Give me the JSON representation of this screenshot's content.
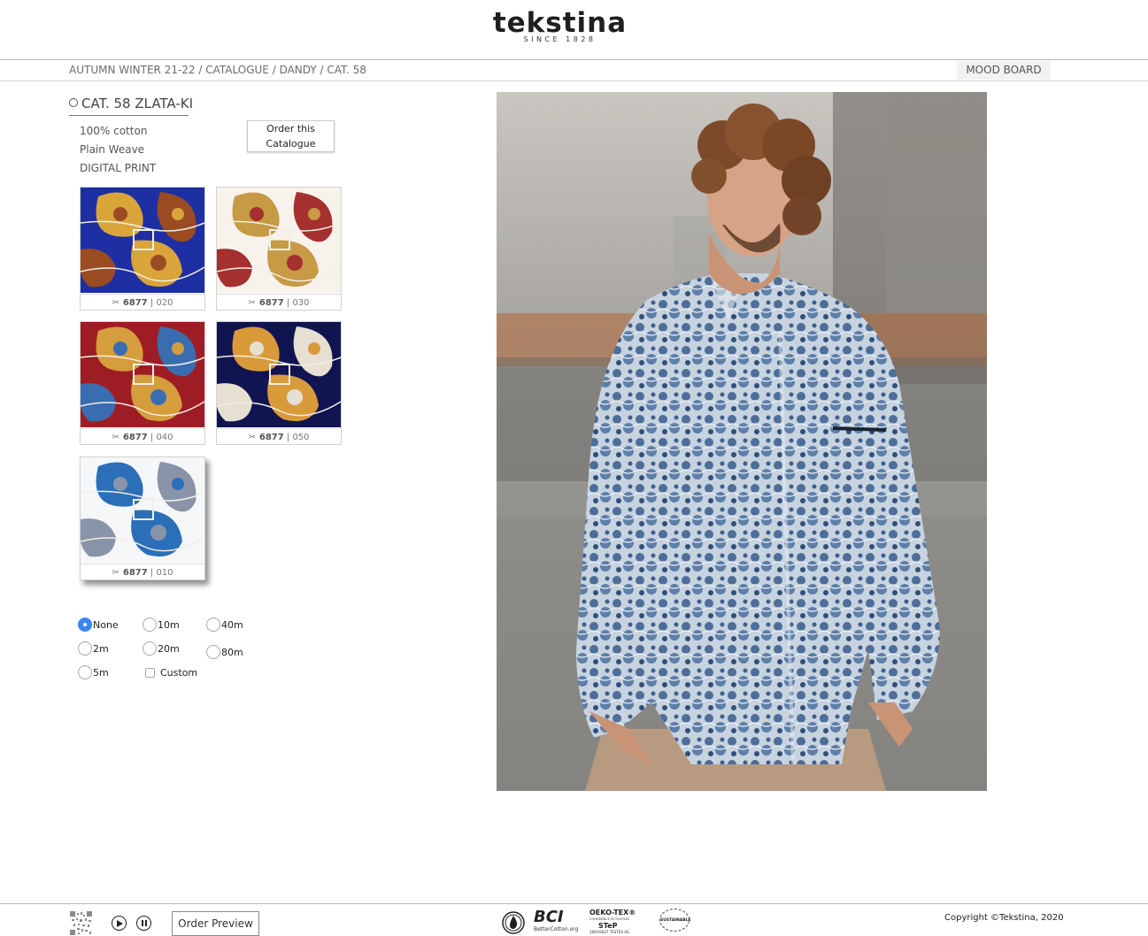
{
  "header": {
    "logo_text": "tekstina",
    "logo_sub": "SINCE 1828",
    "breadcrumb": [
      "AUTUMN WINTER 21-22",
      "CATALOGUE",
      "DANDY",
      "CAT. 58"
    ],
    "breadcrumb_sep": " / ",
    "mood_board_label": "MOOD BOARD"
  },
  "catalogue": {
    "title": "CAT. 58 ZLATA-KI",
    "specs": [
      "100% cotton",
      "Plain Weave",
      "DIGITAL PRINT"
    ],
    "order_label_line1": "Order this",
    "order_label_line2": "Catalogue"
  },
  "swatches": [
    {
      "article": "6877",
      "sep": " | ",
      "color": "020",
      "bg": "#1d2fa3",
      "accent": "#d9a53a",
      "accent2": "#9b4b22",
      "active": false
    },
    {
      "article": "6877",
      "sep": " | ",
      "color": "030",
      "bg": "#f7f3ec",
      "accent": "#c79a45",
      "accent2": "#a43030",
      "active": false
    },
    {
      "article": "6877",
      "sep": " | ",
      "color": "040",
      "bg": "#9e1c24",
      "accent": "#d69d3c",
      "accent2": "#3a6db0",
      "active": false
    },
    {
      "article": "6877",
      "sep": " | ",
      "color": "050",
      "bg": "#101450",
      "accent": "#d99a3a",
      "accent2": "#e6e0d2",
      "active": false
    },
    {
      "article": "6877",
      "sep": " | ",
      "color": "010",
      "bg": "#f6f7f9",
      "accent": "#2b6fb8",
      "accent2": "#8a94a8",
      "active": true
    }
  ],
  "quantity_options": [
    {
      "label": "None",
      "selected": true,
      "kind": "radio"
    },
    {
      "label": "10m",
      "selected": false,
      "kind": "radio"
    },
    {
      "label": "40m",
      "selected": false,
      "kind": "radio"
    },
    {
      "label": "2m",
      "selected": false,
      "kind": "radio"
    },
    {
      "label": "20m",
      "selected": false,
      "kind": "radio"
    },
    {
      "label": "80m",
      "selected": false,
      "kind": "radio"
    },
    {
      "label": "5m",
      "selected": false,
      "kind": "radio"
    },
    {
      "label": "Custom",
      "selected": false,
      "kind": "checkbox"
    }
  ],
  "footer": {
    "order_preview_label": "Order Preview",
    "copyright": "Copyright ©Tekstina, 2020",
    "cert_bci": "BCI",
    "cert_bci_sub": "BetterCotton.org",
    "cert_oeko": "OEKO-TEX®",
    "cert_oeko_line": "CONFIDENCE IN TEXTILES",
    "cert_step": "STeP",
    "cert_oeko_id": "18OO0627 TESTEX AG",
    "cert_sustainable": "SUSTAINABLE"
  },
  "colors": {
    "accent_blue": "#3a86f5",
    "shirt_blue": "#5f7ea3"
  },
  "icons": [
    "qr-code-icon",
    "play-icon",
    "pause-icon",
    "scissors-icon"
  ]
}
